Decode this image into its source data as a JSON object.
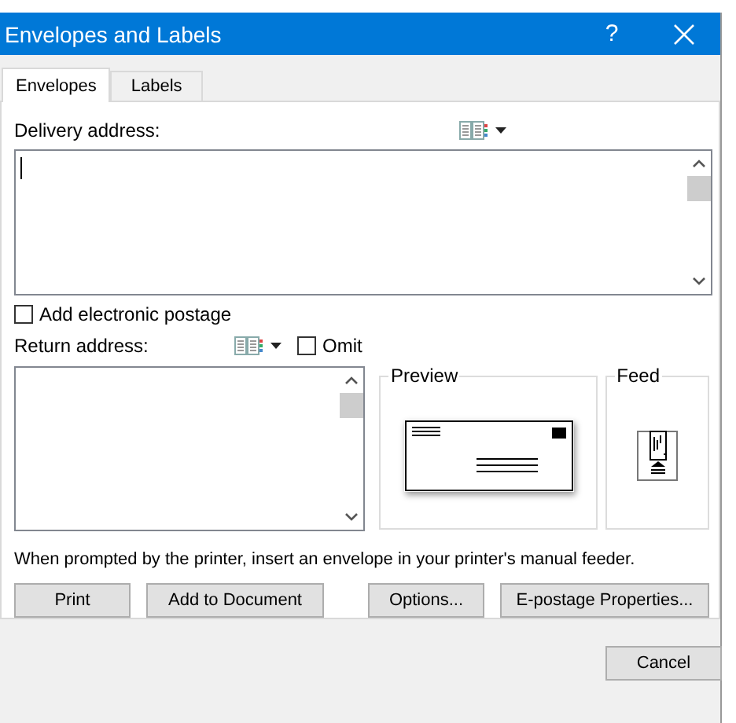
{
  "window": {
    "title": "Envelopes and Labels",
    "help": "?"
  },
  "tabs": [
    {
      "label": "Envelopes",
      "selected": true
    },
    {
      "label": "Labels",
      "selected": false
    }
  ],
  "delivery": {
    "label": "Delivery address:"
  },
  "postage": {
    "label": "Add electronic postage",
    "checked": false
  },
  "return_address": {
    "label": "Return address:",
    "omit": {
      "label": "Omit",
      "checked": false
    }
  },
  "preview": {
    "label": "Preview"
  },
  "feed": {
    "label": "Feed"
  },
  "instruction": "When prompted by the printer, insert an envelope in your printer's manual feeder.",
  "buttons": [
    "Print",
    "Add to Document",
    "Options...",
    "E-postage Properties..."
  ],
  "footer_buttons": [
    "Cancel"
  ]
}
